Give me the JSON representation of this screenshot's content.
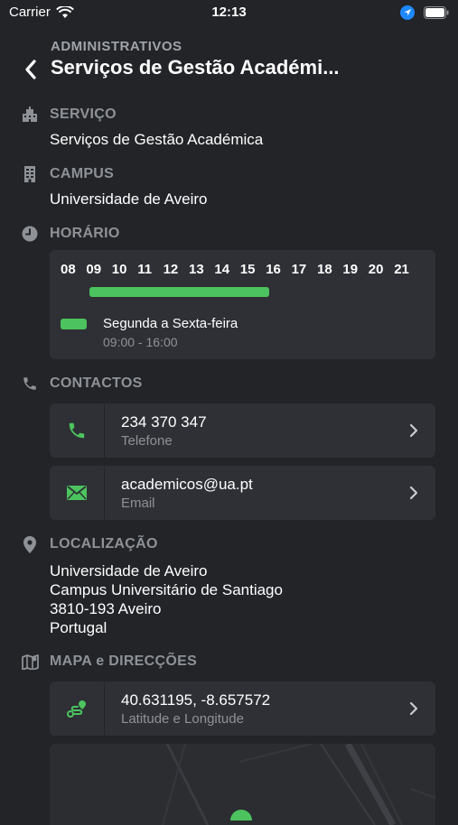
{
  "status_bar": {
    "carrier": "Carrier",
    "time": "12:13"
  },
  "header": {
    "subtitle": "ADMINISTRATIVOS",
    "title": "Serviços de Gestão Académi..."
  },
  "servico": {
    "label": "SERVIÇO",
    "value": "Serviços de Gestão Académica",
    "icon": "building-icon"
  },
  "campus": {
    "label": "CAMPUS",
    "value": "Universidade de Aveiro",
    "icon": "campus-building-icon"
  },
  "horario": {
    "label": "HORÁRIO",
    "icon": "clock-icon",
    "hours": [
      "08",
      "09",
      "10",
      "11",
      "12",
      "13",
      "14",
      "15",
      "16",
      "17",
      "18",
      "19",
      "20",
      "21"
    ],
    "open_from": "09",
    "open_to": "16",
    "legend_title": "Segunda a Sexta-feira",
    "legend_hours": "09:00 - 16:00",
    "accent": "#4cc35e"
  },
  "contactos": {
    "label": "CONTACTOS",
    "icon": "phone-icon",
    "items": [
      {
        "value": "234 370 347",
        "type": "Telefone",
        "icon": "phone-icon"
      },
      {
        "value": "academicos@ua.pt",
        "type": "Email",
        "icon": "mail-icon"
      }
    ]
  },
  "localizacao": {
    "label": "LOCALIZAÇÃO",
    "icon": "location-pin-icon",
    "lines": [
      "Universidade de Aveiro",
      "Campus Universitário de Santiago",
      "3810-193 Aveiro",
      "Portugal"
    ]
  },
  "mapa": {
    "label": "MAPA e DIRECÇÕES",
    "icon": "map-icon",
    "coords": "40.631195, -8.657572",
    "coords_label": "Latitude e Longitude",
    "coords_icon": "route-icon"
  },
  "colors": {
    "background": "#222428",
    "card": "#2e3035",
    "accent": "#4cc35e",
    "muted": "#8e9297"
  }
}
